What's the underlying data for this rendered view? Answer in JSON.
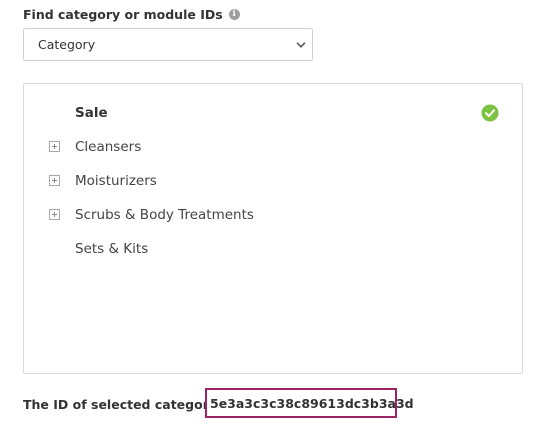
{
  "finder": {
    "label": "Find category or module IDs",
    "info_icon": "info-icon"
  },
  "select": {
    "value": "Category",
    "icon": "chevron-down-icon"
  },
  "tree": {
    "items": [
      {
        "label": "Sale",
        "selected": true,
        "expandable": false
      },
      {
        "label": "Cleansers",
        "selected": false,
        "expandable": true
      },
      {
        "label": "Moisturizers",
        "selected": false,
        "expandable": true
      },
      {
        "label": "Scrubs & Body Treatments",
        "selected": false,
        "expandable": true
      },
      {
        "label": "Sets & Kits",
        "selected": false,
        "expandable": false
      }
    ],
    "selected_icon": "check-circle-icon"
  },
  "result": {
    "prefix": "The ID of selected category is",
    "id": "5e3a3c3c38c89613dc3b3a3d"
  },
  "colors": {
    "check_green": "#7cc242",
    "highlight_border": "#9c2463"
  }
}
